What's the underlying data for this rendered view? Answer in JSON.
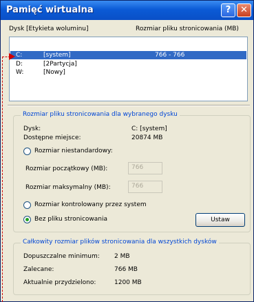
{
  "window": {
    "title": "Pamięć wirtualna",
    "help_icon": "?",
    "close_icon": "✕"
  },
  "list": {
    "col_drive": "Dysk [Etykieta woluminu]",
    "col_size": "Rozmiar pliku stronicowania (MB)",
    "rows": [
      {
        "drive": "C:",
        "label": "[system]",
        "size": "766 - 766",
        "selected": true
      },
      {
        "drive": "D:",
        "label": "[2Partycja]",
        "size": ""
      },
      {
        "drive": "W:",
        "label": "[Nowy]",
        "size": ""
      }
    ]
  },
  "selected_drive": {
    "group_title": "Rozmiar pliku stronicowania dla wybranego dysku",
    "drive_label": "Dysk:",
    "drive_value": "C: [system]",
    "free_label": "Dostępne miejsce:",
    "free_value": "20874 MB",
    "custom_size_label": "Rozmiar niestandardowy:",
    "initial_label": "Rozmiar początkowy (MB):",
    "initial_value": "766",
    "max_label": "Rozmiar maksymalny (MB):",
    "max_value": "766",
    "system_managed_label": "Rozmiar kontrolowany przez system",
    "no_paging_label": "Bez pliku stronicowania",
    "set_button": "Ustaw"
  },
  "totals": {
    "group_title": "Całkowity rozmiar plików stronicowania dla wszystkich dysków",
    "min_label": "Dopuszczalne minimum:",
    "min_value": "2 MB",
    "recommended_label": "Zalecane:",
    "recommended_value": "766 MB",
    "current_label": "Aktualnie przydzielono:",
    "current_value": "1200 MB"
  },
  "colors": {
    "title_bar": "#0b5bd6",
    "selection": "#316ac5",
    "annotation": "#d00000",
    "group_label": "#0046d5"
  }
}
